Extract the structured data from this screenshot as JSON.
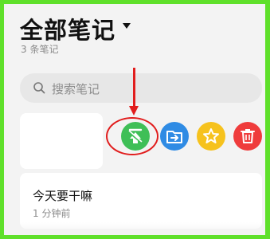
{
  "header": {
    "title": "全部笔记",
    "count_label": "3 条笔记"
  },
  "search": {
    "placeholder": "搜索笔记"
  },
  "actions": {
    "pin_top_icon": "pin-to-top-icon",
    "move_icon": "move-to-folder-icon",
    "favorite_icon": "star-icon",
    "delete_icon": "trash-icon"
  },
  "notes": [
    {
      "title": "今天要干嘛",
      "time": "1 分钟前"
    }
  ],
  "colors": {
    "frame_border": "#5fe02a",
    "pin_button": "#3fbf57",
    "move_button": "#2f8be4",
    "star_button": "#f6c21d",
    "delete_button": "#ef3c3c",
    "annotation": "#e11d1d"
  }
}
